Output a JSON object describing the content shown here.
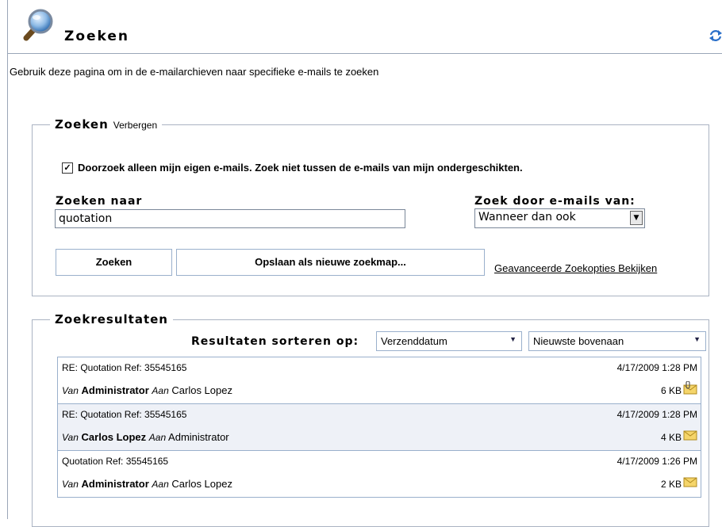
{
  "header": {
    "title": "Zoeken",
    "refresh_icon": "refresh-icon",
    "search_icon": "magnifier-icon"
  },
  "description": "Gebruik deze pagina om in de e-mailarchieven naar specifieke e-mails te zoeken",
  "search_panel": {
    "legend": "Zoeken",
    "hide_link": "Verbergen",
    "own_mails_checked": true,
    "own_mails_label": "Doorzoek alleen mijn eigen e-mails. Zoek niet tussen de e-mails van mijn ondergeschikten.",
    "search_for_label": "Zoeken naar",
    "search_for_value": "quotation",
    "search_period_label": "Zoek door e-mails van:",
    "search_period_value": "Wanneer dan ook",
    "search_button": "Zoeken",
    "save_button": "Opslaan als nieuwe zoekmap...",
    "advanced_link": "Geavanceerde Zoekopties Bekijken"
  },
  "results_panel": {
    "legend": "Zoekresultaten",
    "sort_label": "Resultaten sorteren op:",
    "sort_field": "Verzenddatum",
    "sort_order": "Nieuwste bovenaan",
    "from_prefix": "Van",
    "to_prefix": "Aan",
    "rows": [
      {
        "subject": "RE: Quotation Ref: 35545165",
        "date": "4/17/2009 1:28 PM",
        "from": "Administrator",
        "to": "Carlos Lopez",
        "size": "6 KB",
        "icon": "attachment-envelope-icon"
      },
      {
        "subject": "RE: Quotation Ref: 35545165",
        "date": "4/17/2009 1:28 PM",
        "from": "Carlos Lopez",
        "to": "Administrator",
        "size": "4 KB",
        "icon": "envelope-icon"
      },
      {
        "subject": "Quotation Ref: 35545165",
        "date": "4/17/2009 1:26 PM",
        "from": "Administrator",
        "to": "Carlos Lopez",
        "size": "2 KB",
        "icon": "envelope-icon"
      }
    ]
  },
  "colors": {
    "border": "#9ab0cc",
    "row_alt": "#eef1f7",
    "refresh": "#2a6fc9"
  }
}
